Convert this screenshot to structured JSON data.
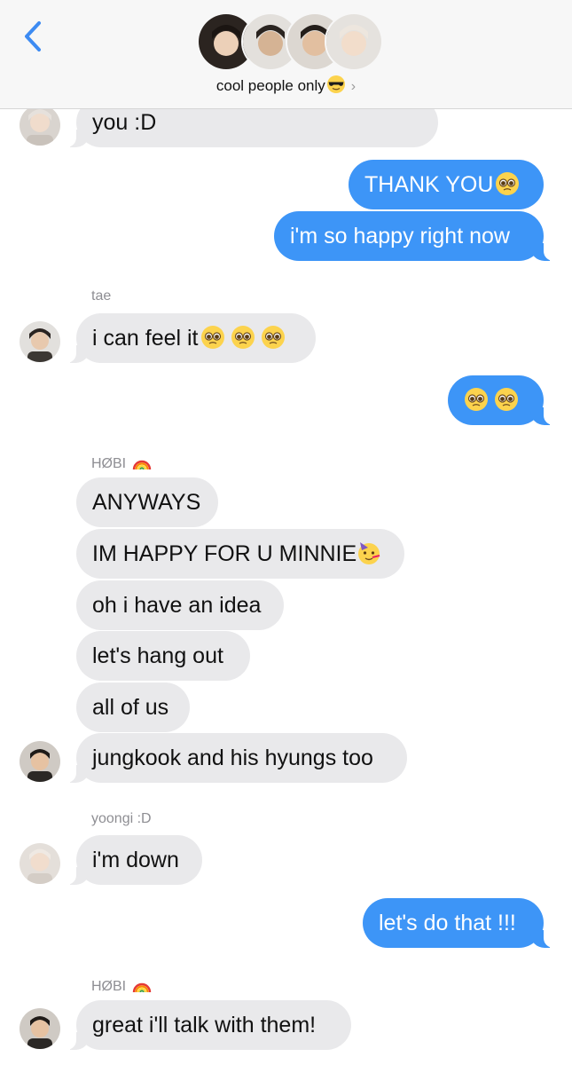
{
  "header": {
    "group_name": "cool people only",
    "group_emoji": "smiling-face-with-sunglasses",
    "chevron": "›",
    "avatars": [
      "member-1",
      "member-2",
      "member-3",
      "member-4"
    ]
  },
  "colors": {
    "incoming_bubble": "#e9e9eb",
    "outgoing_bubble": "#3d95f7",
    "back_accent": "#3d8bf2",
    "sender_label": "#8e8e93"
  },
  "messages": [
    {
      "dir": "in",
      "text": "you :D"
    },
    {
      "dir": "out",
      "text": "THANK YOU",
      "emoji": [
        "pleading-face"
      ]
    },
    {
      "dir": "out",
      "text": "i'm so happy right now"
    },
    {
      "dir": "in",
      "sender": "tae",
      "text": "i can feel it",
      "emoji": [
        "pleading-face",
        "pleading-face",
        "pleading-face"
      ]
    },
    {
      "dir": "out",
      "text": "",
      "emoji": [
        "pleading-face",
        "pleading-face"
      ]
    },
    {
      "dir": "in",
      "sender": "HØBI",
      "sender_emoji": "rainbow",
      "text": "ANYWAYS"
    },
    {
      "dir": "in",
      "text": "IM HAPPY FOR U MINNIE",
      "emoji": [
        "partying-face"
      ]
    },
    {
      "dir": "in",
      "text": "oh i have an idea"
    },
    {
      "dir": "in",
      "text": "let's hang out"
    },
    {
      "dir": "in",
      "text": "all of us"
    },
    {
      "dir": "in",
      "text": "jungkook and his hyungs too"
    },
    {
      "dir": "in",
      "sender": "yoongi :D",
      "text": "i'm down"
    },
    {
      "dir": "out",
      "text": "let's do that !!!"
    },
    {
      "dir": "in",
      "sender": "HØBI",
      "sender_emoji": "rainbow",
      "text": "great i'll talk with them!"
    }
  ]
}
